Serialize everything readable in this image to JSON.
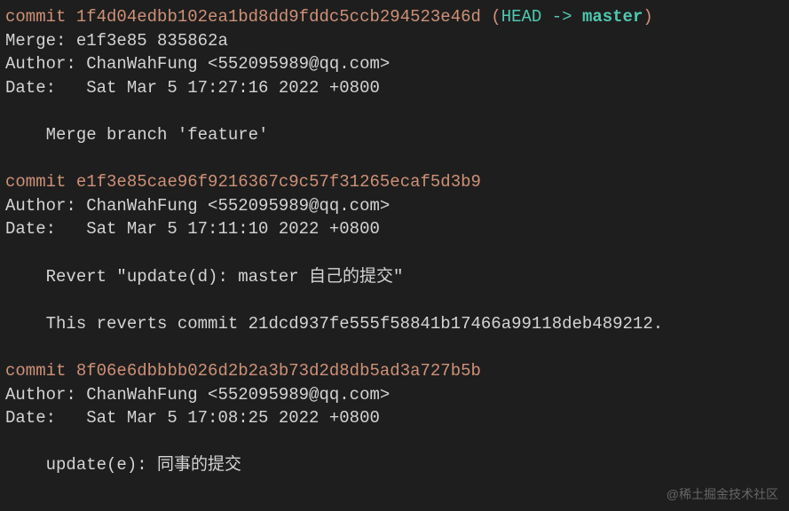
{
  "commits": [
    {
      "hash_prefix": "commit ",
      "hash": "1f4d04edbb102ea1bd8dd9fddc5ccb294523e46d",
      "head_open": " (",
      "head_text": "HEAD -> ",
      "branch": "master",
      "head_close": ")",
      "merge": "Merge: e1f3e85 835862a",
      "author": "Author: ChanWahFung <552095989@qq.com>",
      "date": "Date:   Sat Mar 5 17:27:16 2022 +0800",
      "messages": [
        "    Merge branch 'feature'"
      ]
    },
    {
      "hash_prefix": "commit ",
      "hash": "e1f3e85cae96f9216367c9c57f31265ecaf5d3b9",
      "author": "Author: ChanWahFung <552095989@qq.com>",
      "date": "Date:   Sat Mar 5 17:11:10 2022 +0800",
      "messages": [
        "    Revert \"update(d): master 自己的提交\"",
        "",
        "    This reverts commit 21dcd937fe555f58841b17466a99118deb489212."
      ]
    },
    {
      "hash_prefix": "commit ",
      "hash": "8f06e6dbbbb026d2b2a3b73d2d8db5ad3a727b5b",
      "author": "Author: ChanWahFung <552095989@qq.com>",
      "date": "Date:   Sat Mar 5 17:08:25 2022 +0800",
      "messages": [
        "    update(e): 同事的提交"
      ]
    }
  ],
  "watermark": "@稀土掘金技术社区"
}
